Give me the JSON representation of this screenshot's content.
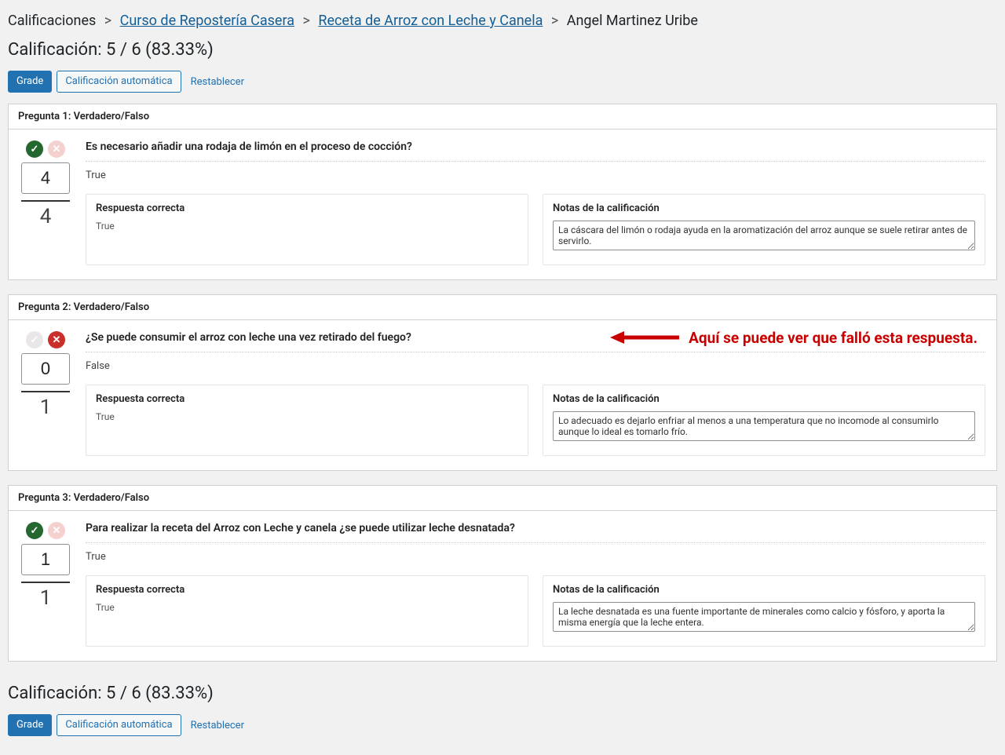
{
  "breadcrumb": {
    "root": "Calificaciones",
    "course": "Curso de Repostería Casera",
    "recipe": "Receta de Arroz con Leche y Canela",
    "student": "Angel Martinez Uribe"
  },
  "grade_summary": "Calificación: 5 / 6 (83.33%)",
  "buttons": {
    "grade": "Grade",
    "auto": "Calificación automática",
    "reset": "Restablecer"
  },
  "labels": {
    "correct_answer": "Respuesta correcta",
    "grade_notes": "Notas de la calificación"
  },
  "annotation": "Aquí se puede ver que falló esta respuesta.",
  "questions": [
    {
      "header": "Pregunta 1: Verdadero/Falso",
      "correct": true,
      "score": "4",
      "denom": "4",
      "question": "Es necesario añadir una rodaja de limón en el proceso de cocción?",
      "student_answer": "True",
      "correct_answer": "True",
      "notes": "La cáscara del limón o rodaja ayuda en la aromatización del arroz aunque se suele retirar antes de servirlo."
    },
    {
      "header": "Pregunta 2: Verdadero/Falso",
      "correct": false,
      "score": "0",
      "denom": "1",
      "question": "¿Se puede consumir el arroz con leche una vez retirado del fuego?",
      "student_answer": "False",
      "correct_answer": "True",
      "notes": "Lo adecuado es dejarlo enfriar al menos a una temperatura que no incomode al consumirlo aunque lo ideal es tomarlo frío."
    },
    {
      "header": "Pregunta 3: Verdadero/Falso",
      "correct": true,
      "score": "1",
      "denom": "1",
      "question": "Para realizar la receta del Arroz con Leche y canela ¿se puede utilizar leche desnatada?",
      "student_answer": "True",
      "correct_answer": "True",
      "notes": "La leche desnatada es una fuente importante de minerales como calcio y fósforo, y aporta la misma energía que la leche entera."
    }
  ]
}
